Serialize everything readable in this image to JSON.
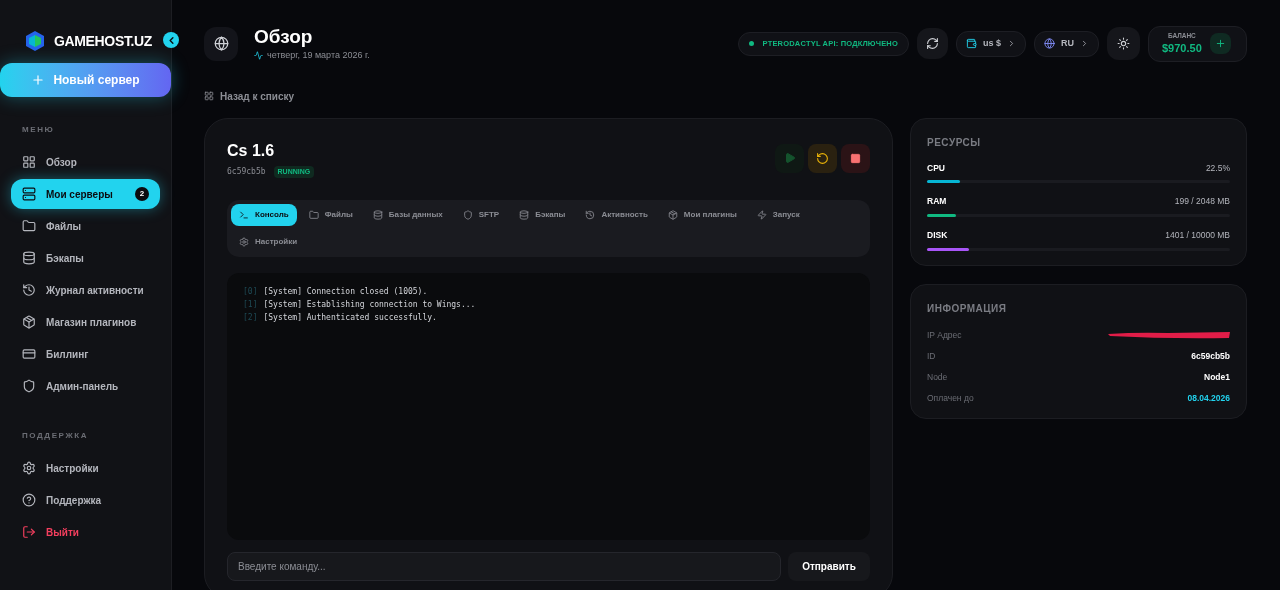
{
  "sidebar": {
    "brand": "GAMEHOST.UZ",
    "new_server": "Новый сервер",
    "sections": [
      {
        "title": "МЕНЮ",
        "items": [
          {
            "label": "Обзор",
            "selected": false,
            "kind": "normal"
          },
          {
            "label": "Мои серверы",
            "selected": true,
            "badge": "2",
            "kind": "normal"
          },
          {
            "label": "Файлы",
            "selected": false,
            "kind": "normal"
          },
          {
            "label": "Бэкапы",
            "selected": false,
            "kind": "normal"
          },
          {
            "label": "Журнал активности",
            "selected": false,
            "kind": "normal"
          },
          {
            "label": "Магазин плагинов",
            "selected": false,
            "kind": "normal"
          },
          {
            "label": "Биллинг",
            "selected": false,
            "kind": "normal"
          },
          {
            "label": "Админ-панель",
            "selected": false,
            "kind": "normal"
          }
        ]
      },
      {
        "title": "ПОДДЕРЖКА",
        "items": [
          {
            "label": "Настройки",
            "selected": false,
            "kind": "normal"
          },
          {
            "label": "Поддержка",
            "selected": false,
            "kind": "normal"
          },
          {
            "label": "Выйти",
            "selected": false,
            "kind": "danger"
          }
        ]
      }
    ]
  },
  "header": {
    "title": "Обзор",
    "date": "четверг, 19 марта 2026 г.",
    "api_status": {
      "label": "PTERODACTYL API: ПОДКЛЮЧЕНО",
      "color": "#10b981"
    },
    "currency": "us $",
    "language": "RU",
    "balance": {
      "label": "БАЛАНС",
      "value": "$970.50"
    }
  },
  "back_link": "Назад к списку",
  "server": {
    "name": "Cs 1.6",
    "id": "6c59cb5b",
    "status": "RUNNING",
    "tabs": [
      {
        "label": "Консоль",
        "selected": true
      },
      {
        "label": "Файлы",
        "selected": false
      },
      {
        "label": "Базы данных",
        "selected": false
      },
      {
        "label": "SFTP",
        "selected": false
      },
      {
        "label": "Бэкапы",
        "selected": false
      },
      {
        "label": "Активность",
        "selected": false
      },
      {
        "label": "Мои плагины",
        "selected": false
      },
      {
        "label": "Запуск",
        "selected": false
      },
      {
        "label": "Настройки",
        "selected": false
      }
    ],
    "console": [
      {
        "index": "[0]",
        "text": "[System] Connection closed (1005)."
      },
      {
        "index": "[1]",
        "text": "[System] Establishing connection to Wings..."
      },
      {
        "index": "[2]",
        "text": "[System] Authenticated successfully."
      }
    ],
    "command": {
      "placeholder": "Введите команду..."
    },
    "send": "Отправить"
  },
  "resources": {
    "title": "РЕСУРСЫ",
    "items": [
      {
        "name": "CPU",
        "reading": "22.5%",
        "level": 0.11,
        "color": "#06b6d4"
      },
      {
        "name": "RAM",
        "reading": "199 / 2048 MB",
        "level": 0.097,
        "color": "#10b981"
      },
      {
        "name": "DISK",
        "reading": "1401 / 10000 MB",
        "level": 0.14,
        "color": "#a855f7"
      }
    ]
  },
  "info": {
    "title": "ИНФОРМАЦИЯ",
    "rows": [
      {
        "label": "IP Адрес",
        "kind": "redacted"
      },
      {
        "label": "ID",
        "value": "6c59cb5b",
        "kind": "plain"
      },
      {
        "label": "Node",
        "value": "Node1",
        "kind": "plain"
      },
      {
        "label": "Оплачен до",
        "value": "08.04.2026",
        "kind": "accent"
      }
    ]
  }
}
